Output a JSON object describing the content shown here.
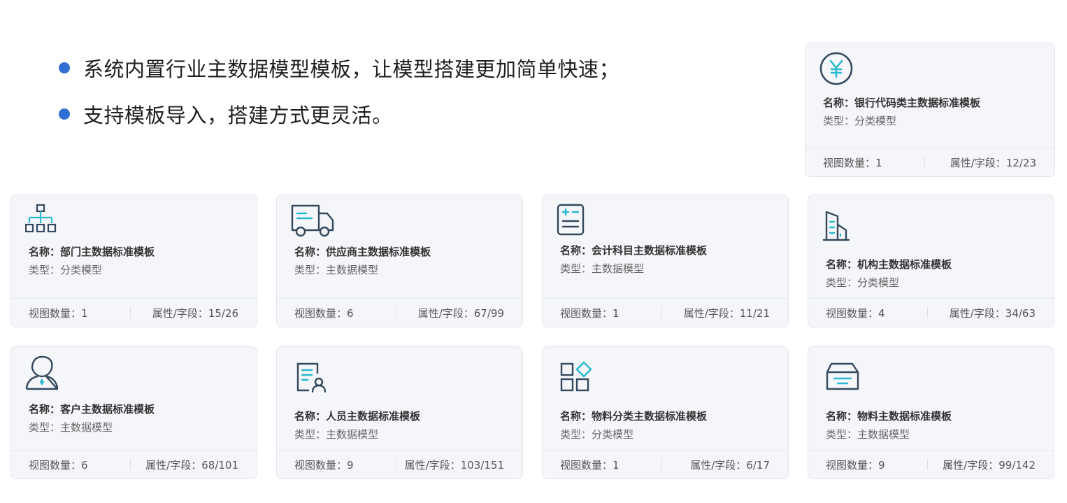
{
  "bullets": [
    "系统内置行业主数据模型模板，让模型搭建更加简单快速；",
    "支持模板导入，搭建方式更灵活。"
  ],
  "colors": {
    "accent": "#2f6fd4",
    "icon_line": "#34495e",
    "icon_accent": "#27b9d1"
  },
  "cards": [
    {
      "icon": "yen-icon",
      "name": "名称：银行代码类主数据标准模板",
      "type": "类型：分类模型",
      "views": "视图数量：1",
      "attrs": "属性/字段：12/23"
    },
    {
      "icon": "org-chart-icon",
      "name": "名称：部门主数据标准模板",
      "type": "类型：分类模型",
      "views": "视图数量：1",
      "attrs": "属性/字段：15/26"
    },
    {
      "icon": "truck-icon",
      "name": "名称：供应商主数据标准模板",
      "type": "类型：主数据模型",
      "views": "视图数量：6",
      "attrs": "属性/字段：67/99"
    },
    {
      "icon": "calculator-icon",
      "name": "名称：会计科目主数据标准模板",
      "type": "类型：主数据模型",
      "views": "视图数量：1",
      "attrs": "属性/字段：11/21"
    },
    {
      "icon": "building-icon",
      "name": "名称：机构主数据标准模板",
      "type": "类型：分类模型",
      "views": "视图数量：4",
      "attrs": "属性/字段：34/63"
    },
    {
      "icon": "customer-icon",
      "name": "名称：客户主数据标准模板",
      "type": "类型：主数据模型",
      "views": "视图数量：6",
      "attrs": "属性/字段：68/101"
    },
    {
      "icon": "person-document-icon",
      "name": "名称：人员主数据标准模板",
      "type": "类型：主数据模型",
      "views": "视图数量：9",
      "attrs": "属性/字段：103/151"
    },
    {
      "icon": "category-grid-icon",
      "name": "名称：物料分类主数据标准模板",
      "type": "类型：分类模型",
      "views": "视图数量：1",
      "attrs": "属性/字段：6/17"
    },
    {
      "icon": "inbox-icon",
      "name": "名称：物料主数据标准模板",
      "type": "类型：主数据模型",
      "views": "视图数量：9",
      "attrs": "属性/字段：99/142"
    }
  ]
}
